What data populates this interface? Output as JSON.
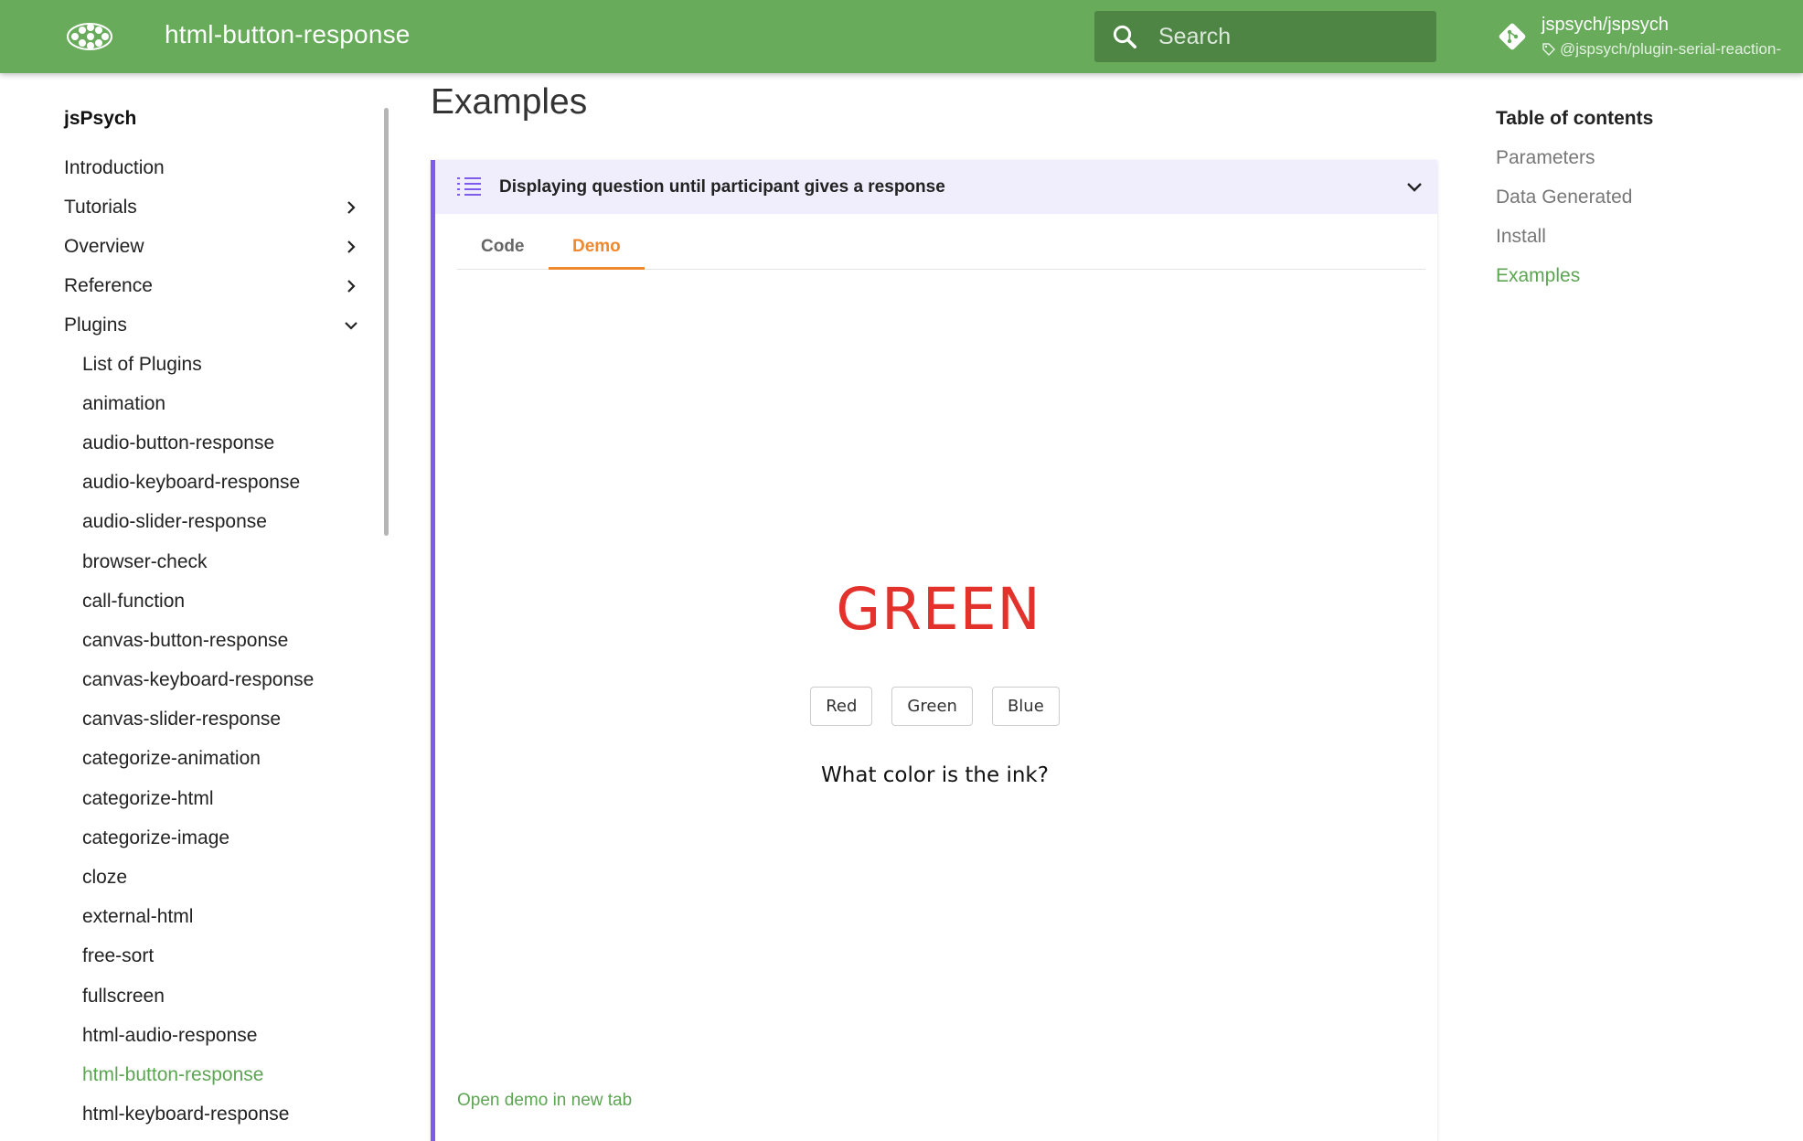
{
  "header": {
    "site_title": "html-button-response",
    "search_placeholder": "Search",
    "repo_name": "jspsych/jspsych",
    "repo_tag": "@jspsych/plugin-serial-reaction-",
    "brand_color": "#67ab5b"
  },
  "nav": {
    "root": "jsPsych",
    "items": [
      {
        "label": "Introduction",
        "chevron": "none"
      },
      {
        "label": "Tutorials",
        "chevron": "right"
      },
      {
        "label": "Overview",
        "chevron": "right"
      },
      {
        "label": "Reference",
        "chevron": "right"
      },
      {
        "label": "Plugins",
        "chevron": "down"
      }
    ],
    "plugins": [
      "List of Plugins",
      "animation",
      "audio-button-response",
      "audio-keyboard-response",
      "audio-slider-response",
      "browser-check",
      "call-function",
      "canvas-button-response",
      "canvas-keyboard-response",
      "canvas-slider-response",
      "categorize-animation",
      "categorize-html",
      "categorize-image",
      "cloze",
      "external-html",
      "free-sort",
      "fullscreen",
      "html-audio-response",
      "html-button-response",
      "html-keyboard-response"
    ],
    "active_plugin": "html-button-response"
  },
  "main": {
    "title": "Examples",
    "example": {
      "title": "Displaying question until participant gives a response",
      "tabs": [
        "Code",
        "Demo"
      ],
      "active_tab": "Demo",
      "demo": {
        "stimulus": "GREEN",
        "stimulus_color": "#e3312b",
        "choices": [
          "Red",
          "Green",
          "Blue"
        ],
        "prompt": "What color is the ink?"
      },
      "open_link": "Open demo in new tab"
    }
  },
  "toc": {
    "title": "Table of contents",
    "items": [
      "Parameters",
      "Data Generated",
      "Install",
      "Examples"
    ],
    "active": "Examples"
  }
}
